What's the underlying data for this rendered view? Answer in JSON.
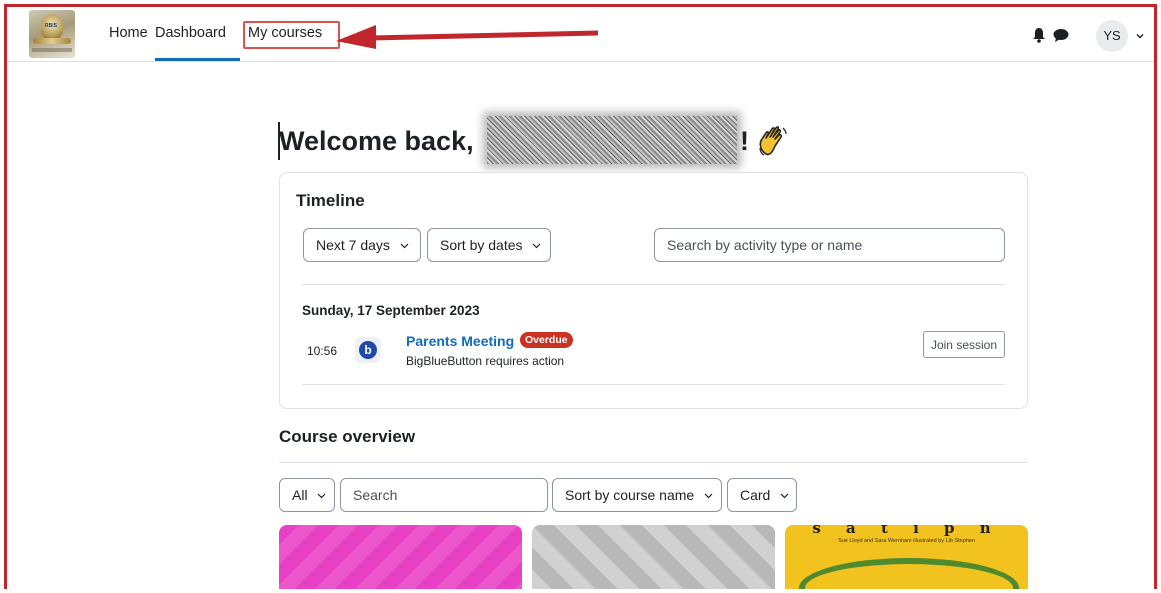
{
  "nav": {
    "logo_text": "RBIS",
    "home": "Home",
    "dashboard": "Dashboard",
    "my_courses": "My courses",
    "avatar_initials": "YS",
    "icons": [
      "bell-icon",
      "chat-icon",
      "chevron-down-icon"
    ]
  },
  "welcome": {
    "prefix": "Welcome back,",
    "suffix": "!"
  },
  "timeline": {
    "title": "Timeline",
    "filter_label": "Next 7 days",
    "sort_label": "Sort by dates",
    "search_placeholder": "Search by activity type or name",
    "date_heading": "Sunday, 17 September 2023",
    "event": {
      "time": "10:56",
      "icon_letter": "b",
      "name": "Parents Meeting",
      "badge": "Overdue",
      "subtitle": "BigBlueButton requires action",
      "action_label": "Join session"
    }
  },
  "course_overview": {
    "title": "Course overview",
    "filter_label": "All",
    "search_placeholder": "Search",
    "sort_label": "Sort by course name",
    "view_label": "Card",
    "cards": [
      {
        "color": "#e840c4"
      },
      {
        "color": "#b8b8b8"
      },
      {
        "color": "#f2c21f",
        "cover_title": "s a t i p n",
        "cover_sub": "Sue Lloyd and Sara Wernham  illustrated by Lib Stephen"
      }
    ]
  },
  "colors": {
    "accent": "#0f6cbf",
    "overdue": "#ca3120",
    "annotation": "#c0272d"
  }
}
